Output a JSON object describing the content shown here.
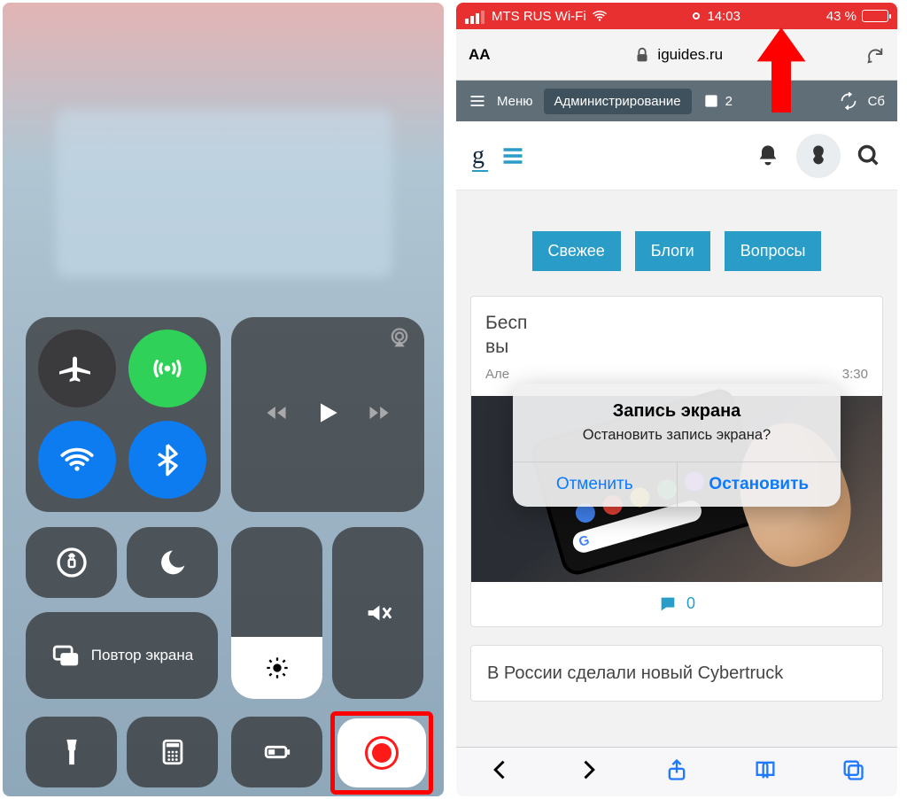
{
  "left": {
    "screen_mirror": "Повтор экрана"
  },
  "right": {
    "status": {
      "carrier": "MTS RUS Wi-Fi",
      "time": "14:03",
      "battery": "43 %"
    },
    "address": "iguides.ru",
    "font_btn": "AA",
    "admin": {
      "menu": "Меню",
      "admin_btn": "Администрирование",
      "badge_count": "2",
      "reset_short": "Сб"
    },
    "logo": "g",
    "tabs": [
      "Свежее",
      "Блоги",
      "Вопросы"
    ],
    "article1": {
      "title_line1": "Бесп",
      "title_line2": "вы",
      "author": "Але",
      "time": "3:30",
      "comments": "0"
    },
    "article2": {
      "title": "В России сделали новый Cybertruck"
    },
    "alert": {
      "title": "Запись экрана",
      "message": "Остановить запись экрана?",
      "cancel": "Отменить",
      "stop": "Остановить"
    }
  }
}
